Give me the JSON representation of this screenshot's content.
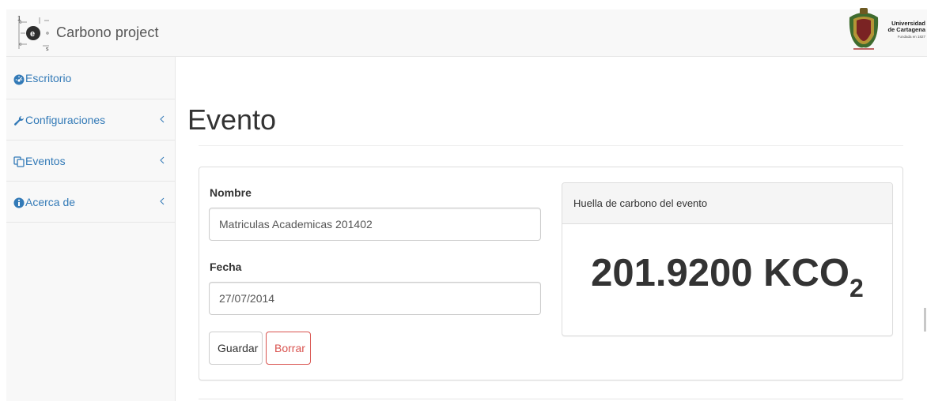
{
  "brand": {
    "name": "Carbono project",
    "logo_icon": "carbono-logo-icon"
  },
  "university": {
    "line1": "Universidad",
    "line2": "de Cartagena",
    "line3": "Fundada en 1827",
    "logo_icon": "university-shield-icon"
  },
  "sidebar": {
    "items": [
      {
        "label": "Escritorio",
        "icon": "dashboard-icon",
        "has_chevron": false
      },
      {
        "label": "Configuraciones",
        "icon": "wrench-icon",
        "has_chevron": true
      },
      {
        "label": "Eventos",
        "icon": "copy-icon",
        "has_chevron": true
      },
      {
        "label": "Acerca de",
        "icon": "info-icon",
        "has_chevron": true
      }
    ]
  },
  "page": {
    "title": "Evento"
  },
  "form": {
    "nombre_label": "Nombre",
    "nombre_value": "Matriculas Academicas 201402",
    "fecha_label": "Fecha",
    "fecha_value": "27/07/2014",
    "save_label": "Guardar",
    "delete_label": "Borrar"
  },
  "footprint": {
    "heading": "Huella de carbono del evento",
    "value": "201.9200",
    "unit": "KCO",
    "unit_subscript": "2"
  },
  "colors": {
    "link": "#337ab7",
    "danger": "#d9534f",
    "panel_border": "#dddddd"
  }
}
